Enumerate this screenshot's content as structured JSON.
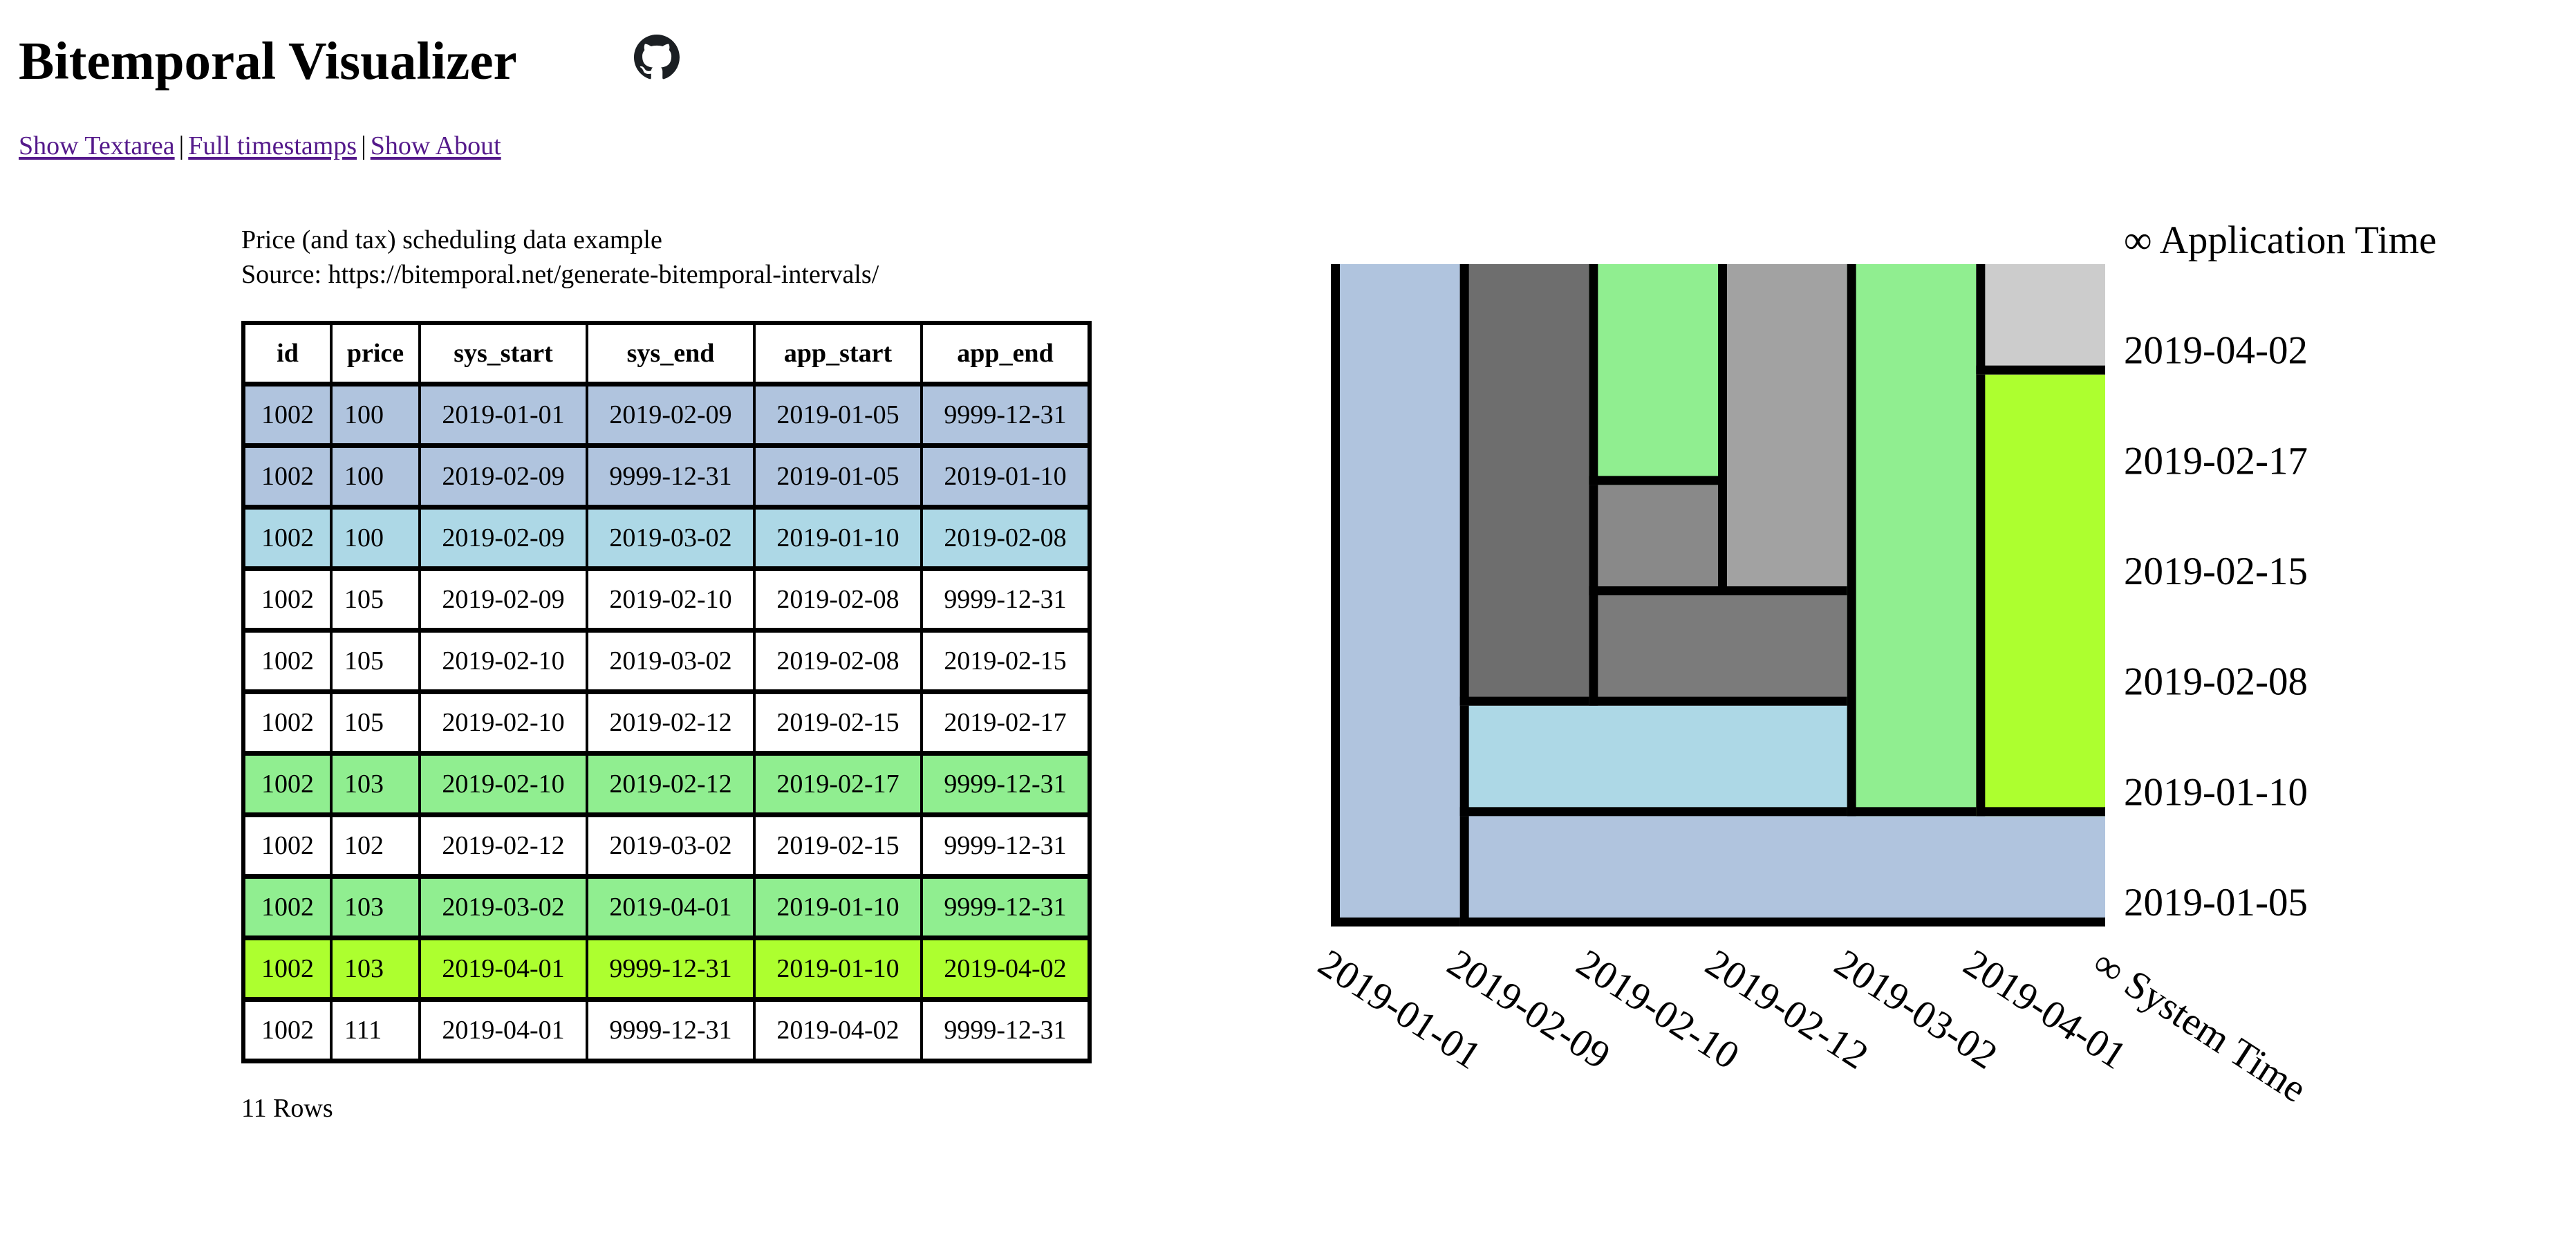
{
  "header": {
    "title": "Bitemporal Visualizer",
    "github_icon": "github-icon"
  },
  "nav": {
    "links": [
      {
        "label": "Show Textarea"
      },
      {
        "label": "Full timestamps"
      },
      {
        "label": "Show About"
      }
    ],
    "separator": "|"
  },
  "dataset": {
    "title": "Price (and tax) scheduling data example",
    "source": "Source: https://bitemporal.net/generate-bitemporal-intervals/",
    "row_count_label": "11 Rows"
  },
  "colors": {
    "lightsteelblue": "#B0C4DE",
    "lightblue": "#ADD8E6",
    "white": "#FFFFFF",
    "lightgreen": "#90EE90",
    "greenyellow": "#ADFF2F",
    "gray1": "#6E6E6E",
    "gray2": "#7B7B7B",
    "gray3": "#898989",
    "gray4": "#A2A2A2",
    "gray5": "#CCCCCC",
    "border": "#000000",
    "link": "#551A8B"
  },
  "table": {
    "columns": [
      "id",
      "price",
      "sys_start",
      "sys_end",
      "app_start",
      "app_end"
    ],
    "rows": [
      {
        "cells": [
          "1002",
          "100",
          "2019-01-01",
          "2019-02-09",
          "2019-01-05",
          "9999-12-31"
        ],
        "color": "#B0C4DE"
      },
      {
        "cells": [
          "1002",
          "100",
          "2019-02-09",
          "9999-12-31",
          "2019-01-05",
          "2019-01-10"
        ],
        "color": "#B0C4DE"
      },
      {
        "cells": [
          "1002",
          "100",
          "2019-02-09",
          "2019-03-02",
          "2019-01-10",
          "2019-02-08"
        ],
        "color": "#ADD8E6"
      },
      {
        "cells": [
          "1002",
          "105",
          "2019-02-09",
          "2019-02-10",
          "2019-02-08",
          "9999-12-31"
        ],
        "color": "#FFFFFF"
      },
      {
        "cells": [
          "1002",
          "105",
          "2019-02-10",
          "2019-03-02",
          "2019-02-08",
          "2019-02-15"
        ],
        "color": "#FFFFFF"
      },
      {
        "cells": [
          "1002",
          "105",
          "2019-02-10",
          "2019-02-12",
          "2019-02-15",
          "2019-02-17"
        ],
        "color": "#FFFFFF"
      },
      {
        "cells": [
          "1002",
          "103",
          "2019-02-10",
          "2019-02-12",
          "2019-02-17",
          "9999-12-31"
        ],
        "color": "#90EE90"
      },
      {
        "cells": [
          "1002",
          "102",
          "2019-02-12",
          "2019-03-02",
          "2019-02-15",
          "9999-12-31"
        ],
        "color": "#FFFFFF"
      },
      {
        "cells": [
          "1002",
          "103",
          "2019-03-02",
          "2019-04-01",
          "2019-01-10",
          "9999-12-31"
        ],
        "color": "#90EE90"
      },
      {
        "cells": [
          "1002",
          "103",
          "2019-04-01",
          "9999-12-31",
          "2019-01-10",
          "2019-04-02"
        ],
        "color": "#ADFF2F"
      },
      {
        "cells": [
          "1002",
          "111",
          "2019-04-01",
          "9999-12-31",
          "2019-04-02",
          "9999-12-31"
        ],
        "color": "#FFFFFF"
      }
    ]
  },
  "chart_data": {
    "type": "heatmap",
    "title": "",
    "xlabel": "∞ System Time",
    "ylabel": "∞ Application Time",
    "x_ticks": [
      "2019-01-01",
      "2019-02-09",
      "2019-02-10",
      "2019-02-12",
      "2019-03-02",
      "2019-04-01"
    ],
    "x_end_label": "∞ System Time",
    "y_ticks": [
      "2019-01-05",
      "2019-01-10",
      "2019-02-08",
      "2019-02-15",
      "2019-02-17",
      "2019-04-02"
    ],
    "y_end_label": "∞ Application Time",
    "x_scale": "ordinal-boundaries",
    "y_scale": "ordinal-boundaries",
    "rectangles": [
      {
        "price": 100,
        "sys_start": "2019-01-01",
        "sys_end": "∞",
        "sys_end_raw": "2019-02-09",
        "app_start": "2019-01-05",
        "app_end": "∞",
        "color": "#B0C4DE"
      },
      {
        "price": 100,
        "sys_start": "2019-02-09",
        "sys_end": "∞",
        "app_start": "2019-01-05",
        "app_end": "2019-01-10",
        "color": "#B0C4DE"
      },
      {
        "price": 100,
        "sys_start": "2019-02-09",
        "sys_end": "2019-03-02",
        "app_start": "2019-01-10",
        "app_end": "2019-02-08",
        "color": "#ADD8E6"
      },
      {
        "price": 105,
        "sys_start": "2019-02-09",
        "sys_end": "2019-02-10",
        "app_start": "2019-02-08",
        "app_end": "∞",
        "color": "#6E6E6E"
      },
      {
        "price": 105,
        "sys_start": "2019-02-10",
        "sys_end": "2019-03-02",
        "app_start": "2019-02-08",
        "app_end": "2019-02-15",
        "color": "#7B7B7B"
      },
      {
        "price": 105,
        "sys_start": "2019-02-10",
        "sys_end": "2019-02-12",
        "app_start": "2019-02-15",
        "app_end": "2019-02-17",
        "color": "#898989"
      },
      {
        "price": 103,
        "sys_start": "2019-02-10",
        "sys_end": "2019-02-12",
        "app_start": "2019-02-17",
        "app_end": "∞",
        "color": "#90EE90"
      },
      {
        "price": 102,
        "sys_start": "2019-02-12",
        "sys_end": "2019-03-02",
        "app_start": "2019-02-15",
        "app_end": "∞",
        "color": "#A2A2A2"
      },
      {
        "price": 103,
        "sys_start": "2019-03-02",
        "sys_end": "2019-04-01",
        "app_start": "2019-01-10",
        "app_end": "∞",
        "color": "#90EE90"
      },
      {
        "price": 103,
        "sys_start": "2019-04-01",
        "sys_end": "∞",
        "app_start": "2019-01-10",
        "app_end": "2019-04-02",
        "color": "#ADFF2F"
      },
      {
        "price": 111,
        "sys_start": "2019-04-01",
        "sys_end": "∞",
        "app_start": "2019-04-02",
        "app_end": "∞",
        "color": "#CCCCCC"
      }
    ]
  }
}
